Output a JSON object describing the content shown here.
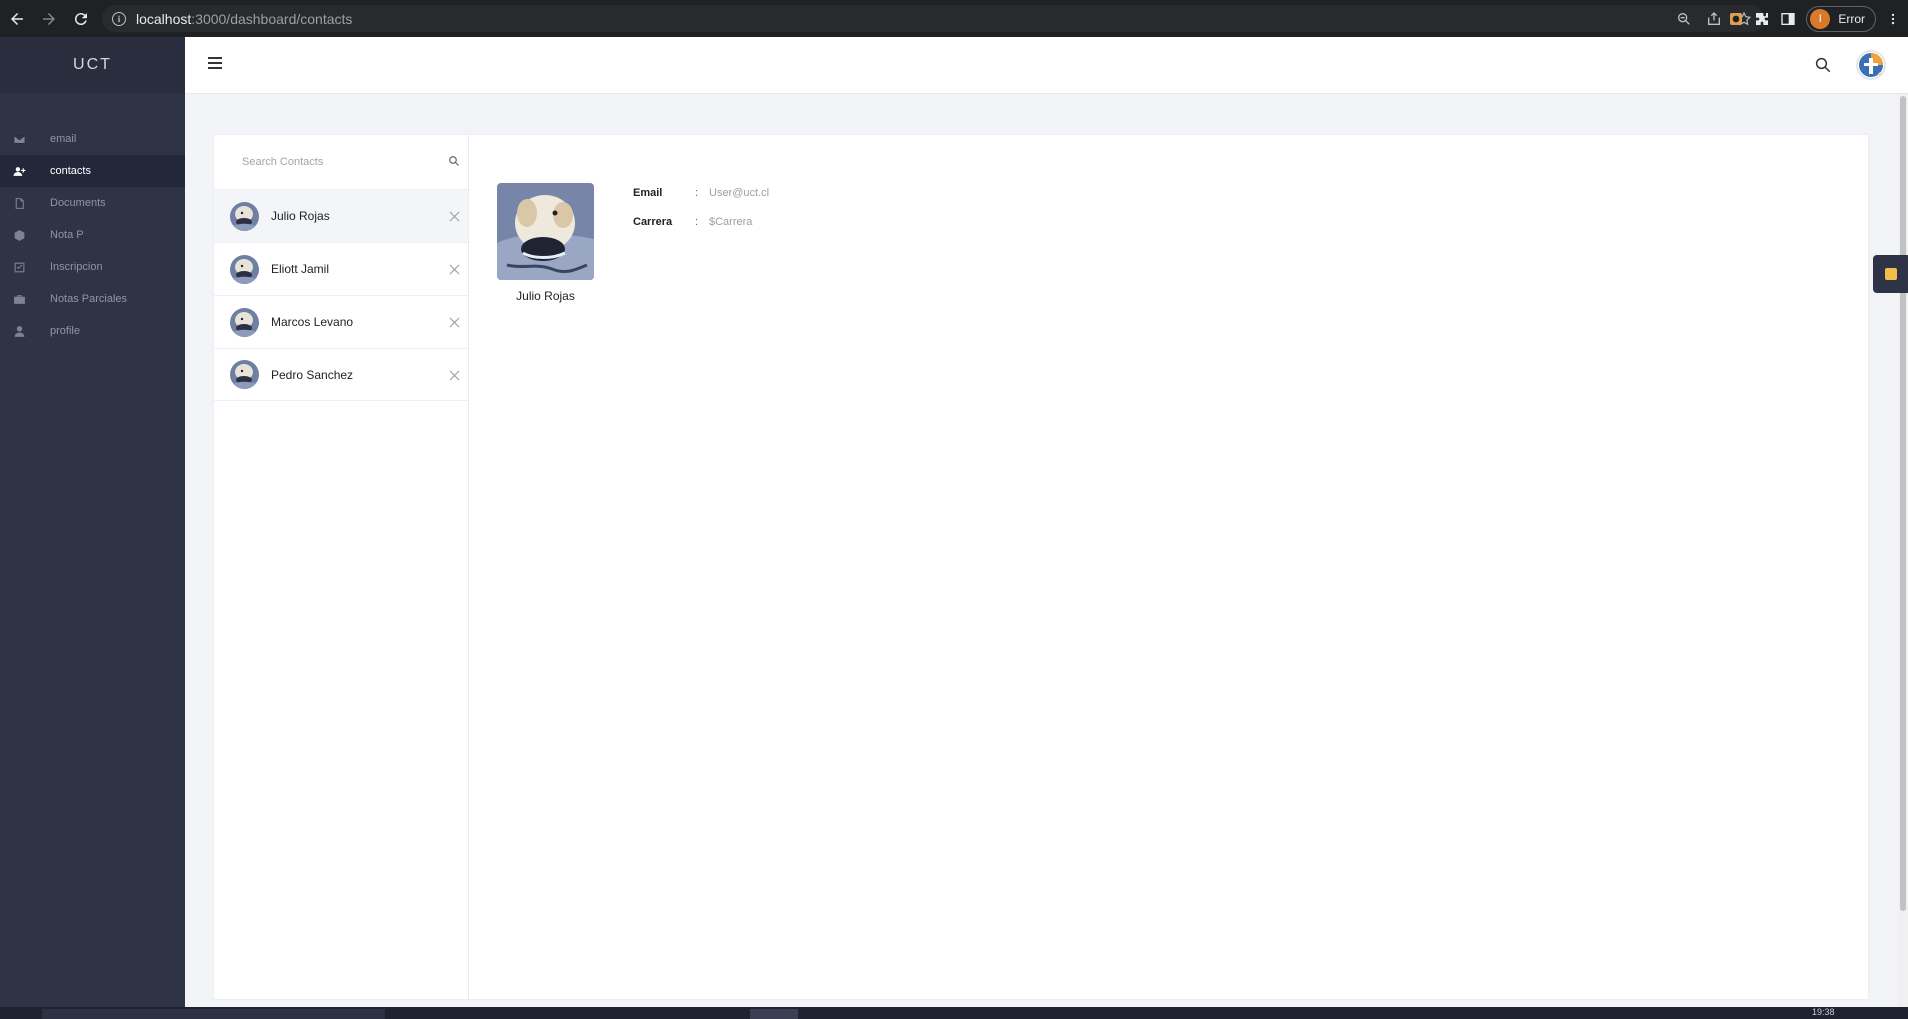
{
  "browser": {
    "url_host": "localhost",
    "url_path": ":3000/dashboard/contacts",
    "profile_initial": "I",
    "profile_label": "Error"
  },
  "sidebar": {
    "brand": "UCT",
    "items": [
      {
        "label": "email",
        "icon": "envelope-icon"
      },
      {
        "label": "contacts",
        "icon": "user-plus-icon",
        "active": true
      },
      {
        "label": "Documents",
        "icon": "document-icon"
      },
      {
        "label": "Nota P",
        "icon": "cube-icon"
      },
      {
        "label": "Inscripcion",
        "icon": "checkbox-icon"
      },
      {
        "label": "Notas Parciales",
        "icon": "briefcase-icon"
      },
      {
        "label": "profile",
        "icon": "user-icon"
      }
    ]
  },
  "contacts": {
    "search_placeholder": "Search Contacts",
    "list": [
      {
        "name": "Julio Rojas"
      },
      {
        "name": "Eliott Jamil"
      },
      {
        "name": "Marcos Levano"
      },
      {
        "name": "Pedro Sanchez"
      }
    ],
    "selected_index": 0
  },
  "detail": {
    "name": "Julio Rojas",
    "email_label": "Email",
    "email_value": "User@uct.cl",
    "carrera_label": "Carrera",
    "carrera_value": "$Carrera",
    "separator": ":"
  },
  "taskbar": {
    "time": "19:38"
  },
  "colors": {
    "sidebar_bg": "#2f3346",
    "brand_bg": "#292d3e",
    "active_item_bg": "#23273a",
    "content_bg": "#f3f4f7"
  }
}
